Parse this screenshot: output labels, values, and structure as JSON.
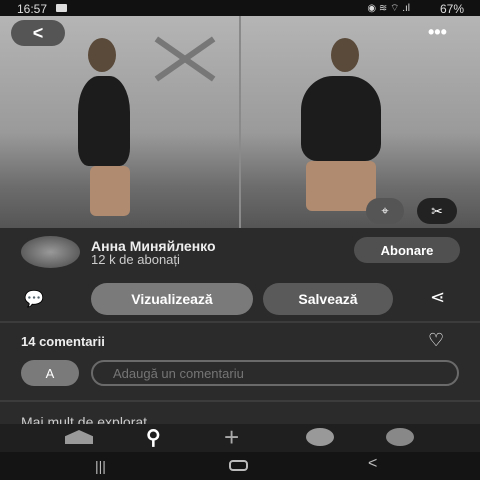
{
  "status": {
    "time": "16:57",
    "battery": "67%",
    "icons": [
      "image-icon",
      "camera-icon",
      "hotspot-icon",
      "wifi-icon",
      "volte-icon",
      "signal-icon",
      "battery-icon"
    ]
  },
  "photo": {
    "back_icon": "chevron-left-icon",
    "more_icon": "more-horizontal-icon",
    "lens_icon": "visual-search-icon",
    "scissors_icon": "scissors-icon"
  },
  "user": {
    "name": "Анна Миняйленко",
    "followers": "12 k de abonați",
    "follow_label": "Abonare"
  },
  "actions": {
    "view_label": "Vizualizează",
    "save_label": "Salvează"
  },
  "comments": {
    "count_label": "14 comentarii",
    "avatar_letter": "A",
    "placeholder": "Adaugă un comentariu"
  },
  "more": {
    "label": "Mai mult de explorat"
  },
  "nav": [
    "home-icon",
    "search-icon",
    "plus-icon",
    "messages-icon",
    "profile-icon"
  ]
}
